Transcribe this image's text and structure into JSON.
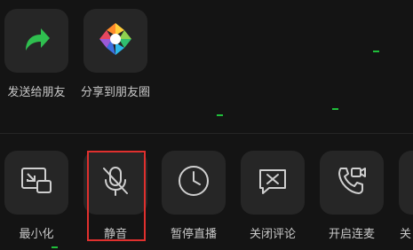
{
  "share_row": {
    "items": [
      {
        "label": "发送给朋友",
        "icon": "forward-arrow-icon"
      },
      {
        "label": "分享到朋友圈",
        "icon": "moments-icon"
      }
    ]
  },
  "action_row": {
    "items": [
      {
        "label": "最小化",
        "icon": "minimize-window-icon"
      },
      {
        "label": "静音",
        "icon": "mic-muted-icon"
      },
      {
        "label": "暂停直播",
        "icon": "clock-icon"
      },
      {
        "label": "关闭评论",
        "icon": "comment-off-icon"
      },
      {
        "label": "开启连麦",
        "icon": "phone-video-icon"
      },
      {
        "label": "关",
        "icon": "unknown-icon"
      }
    ]
  },
  "colors": {
    "highlight": "#e0302e",
    "forward_arrow": "#2fbf4f",
    "tile": "#262626",
    "background": "#141414"
  }
}
